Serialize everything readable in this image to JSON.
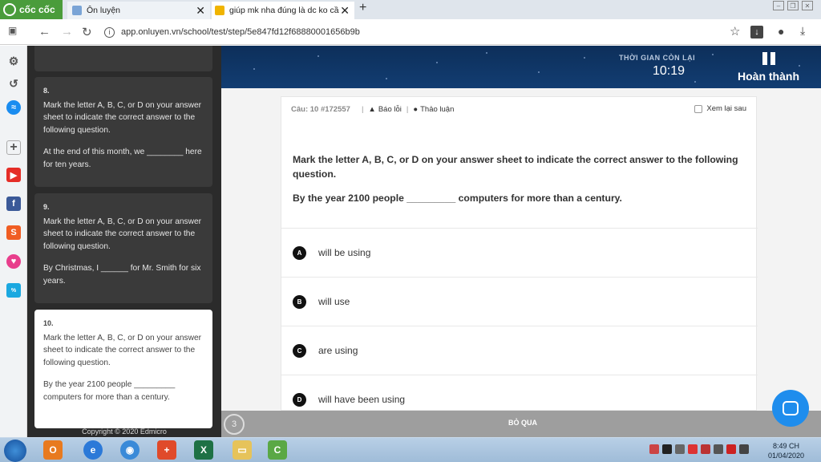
{
  "browser": {
    "brand_label": "cốc cốc",
    "tabs": [
      {
        "title": "Ôn luyện"
      },
      {
        "title": "giúp mk nha đúng là dc ko cầ"
      }
    ],
    "url": "app.onluyen.vn/school/test/step/5e847fd12f68880001656b9b"
  },
  "question_list": {
    "items": [
      {
        "number": "8.",
        "instruction": "Mark the letter A, B, C, or D on your answer sheet to indicate the correct answer to the following question.",
        "text": "At the end of this month, we ________ here for ten years."
      },
      {
        "number": "9.",
        "instruction": "Mark the letter A, B, C, or D on your answer sheet to indicate the correct answer to the following question.",
        "text": "By Christmas, I ______ for Mr. Smith for six years."
      },
      {
        "number": "10.",
        "instruction": "Mark the letter A, B, C, or D on your answer sheet to indicate the correct answer to the following question.",
        "text": "By the year 2100 people _________ computers for more than a century."
      }
    ],
    "copyright": "Copyright © 2020 Edmicro"
  },
  "header": {
    "timer_label": "THỜI GIAN CÒN LẠI",
    "timer_value": "10:19",
    "finish_label": "Hoàn thành"
  },
  "question": {
    "code": "Câu: 10 #172557",
    "report_label": "Báo lỗi",
    "discuss_label": "Thảo luận",
    "later_label": "Xem lại sau",
    "instruction": "Mark the letter A, B, C, or D on your answer sheet to indicate the correct answer to the following question.",
    "text": "By the year 2100 people _________ computers for more than a century.",
    "options": [
      {
        "letter": "A",
        "text": "will be using"
      },
      {
        "letter": "B",
        "text": "will use"
      },
      {
        "letter": "C",
        "text": "are using"
      },
      {
        "letter": "D",
        "text": "will have been using"
      }
    ]
  },
  "footer": {
    "counter": "3",
    "skip_label": "BỎ QUA"
  },
  "taskbar": {
    "time": "8:49 CH",
    "date": "01/04/2020"
  }
}
